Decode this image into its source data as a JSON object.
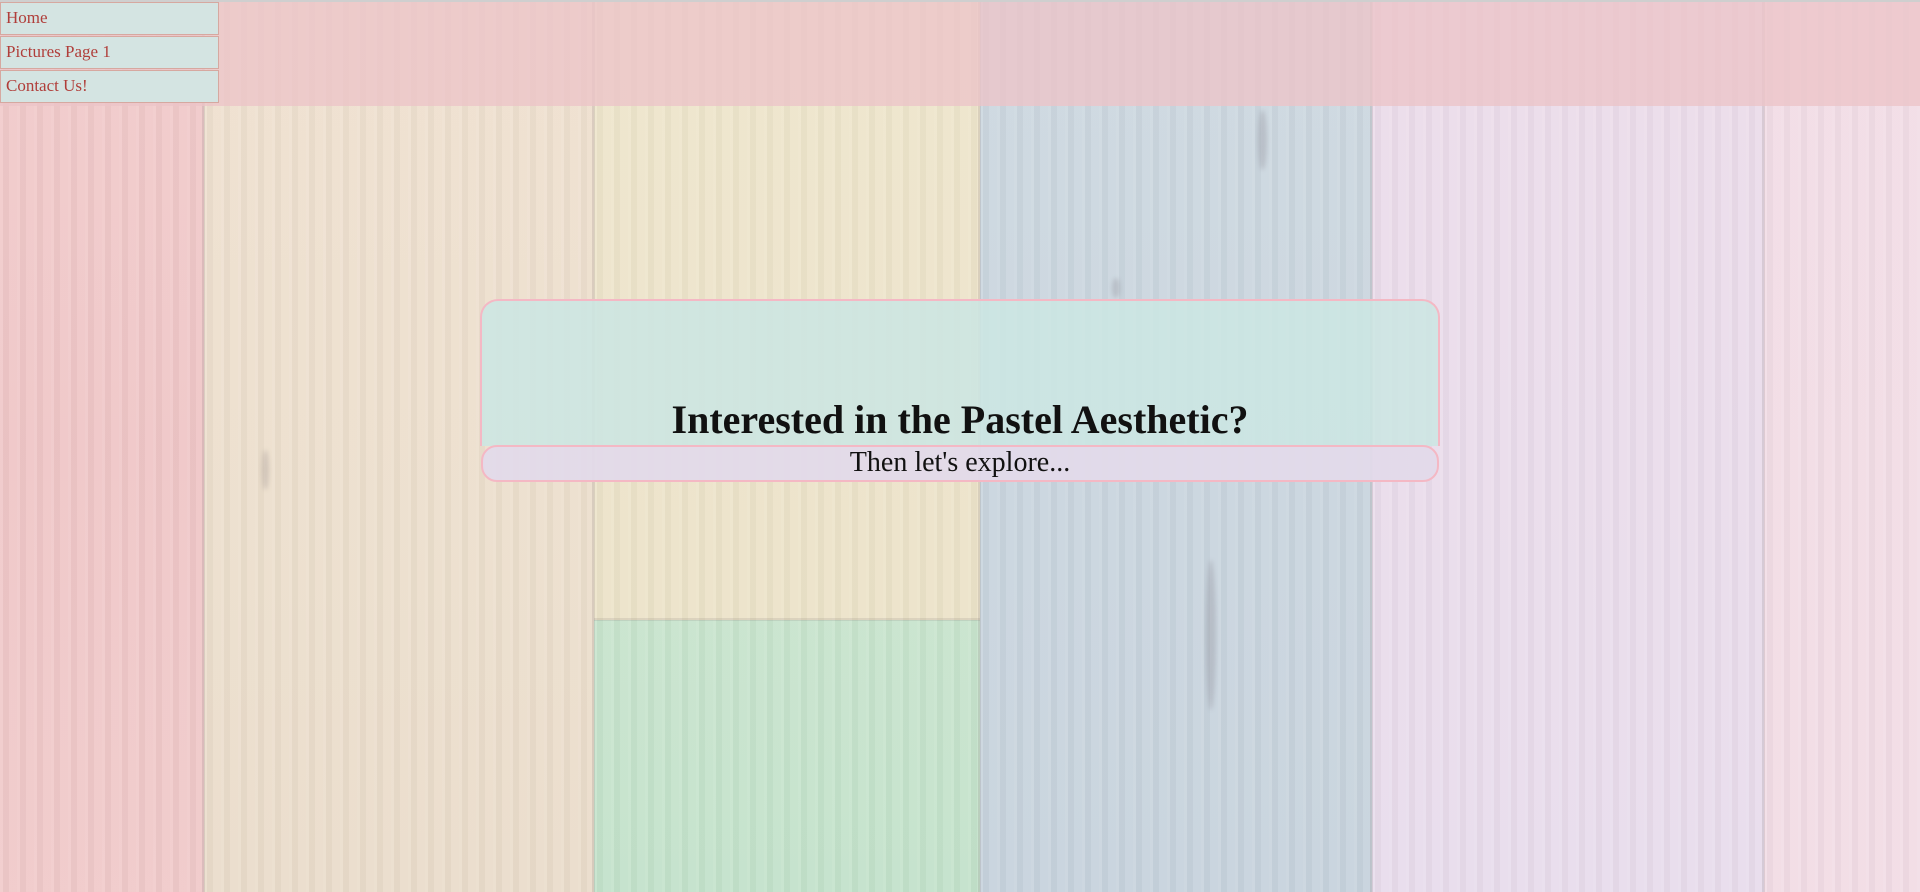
{
  "nav": {
    "items": [
      {
        "label": "Home"
      },
      {
        "label": "Pictures Page 1"
      },
      {
        "label": "Contact Us!"
      }
    ]
  },
  "hero": {
    "title": "Interested in the Pastel Aesthetic?",
    "subtitle": "Then let's explore..."
  },
  "colors": {
    "nav_background": "#d4e4e2",
    "nav_text": "#b03e3a",
    "nav_border": "#d6a8a0",
    "header_band": "#ecc4c8",
    "hero_background": "#cce6e2",
    "hero_border": "#f4b8c4",
    "subtitle_background": "#e2daea"
  }
}
